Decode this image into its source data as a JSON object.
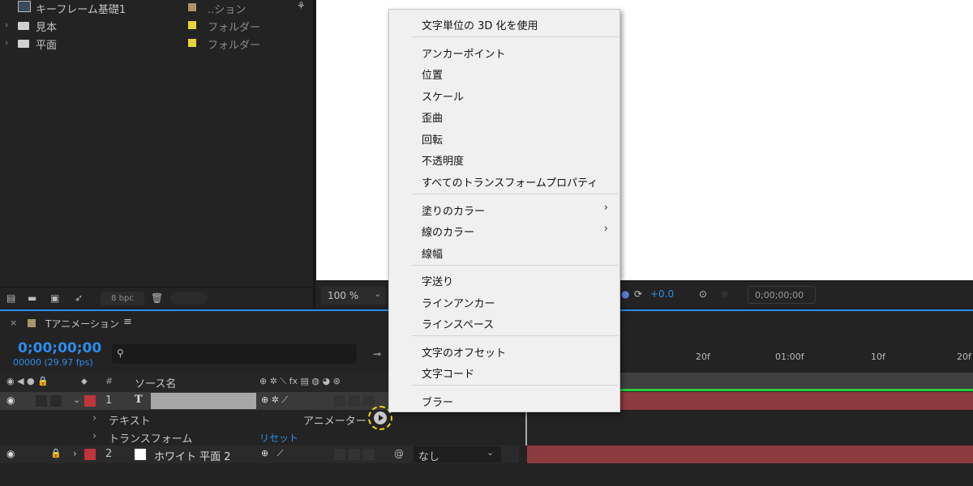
{
  "project": {
    "items": [
      {
        "name": "キーフレーム基礎1",
        "type": "..ション",
        "swatch": "#a89468"
      },
      {
        "name": "見本",
        "type": "フォルダー",
        "swatch": "#e4d43a"
      },
      {
        "name": "平面",
        "type": "フォルダー",
        "swatch": "#e4d43a"
      }
    ],
    "footer": {
      "bpc": "8 bpc"
    }
  },
  "viewer": {
    "zoom": "100 %",
    "exposure": "+0.0",
    "timecode": "0;00;00;00"
  },
  "timeline": {
    "tab_title": "Tアニメーション",
    "timecode": "0;00;00;00",
    "frame_info": "00000 (29.97 fps)",
    "col_source_name": "ソース名",
    "col_hash": "#",
    "ruler_ticks": [
      "20f",
      "01:00f",
      "10f",
      "20f"
    ],
    "layers": [
      {
        "index": "1",
        "type_icon": "T",
        "name": "",
        "label_color": "#c0343a"
      },
      {
        "index": "2",
        "name": "ホワイト 平面 2",
        "label_color": "#c0343a",
        "parent": "なし"
      }
    ],
    "sub_rows": [
      {
        "label": "テキスト",
        "right": "アニメーター"
      },
      {
        "label": "トランスフォーム",
        "right": "リセット"
      }
    ]
  },
  "menu": {
    "groups": [
      [
        {
          "label": "文字単位の 3D 化を使用"
        }
      ],
      [
        {
          "label": "アンカーポイント"
        },
        {
          "label": "位置"
        },
        {
          "label": "スケール"
        },
        {
          "label": "歪曲"
        },
        {
          "label": "回転"
        },
        {
          "label": "不透明度"
        },
        {
          "label": "すべてのトランスフォームプロパティ"
        }
      ],
      [
        {
          "label": "塗りのカラー",
          "submenu": true
        },
        {
          "label": "線のカラー",
          "submenu": true
        },
        {
          "label": "線幅"
        }
      ],
      [
        {
          "label": "字送り"
        },
        {
          "label": "ラインアンカー"
        },
        {
          "label": "ラインスペース"
        }
      ],
      [
        {
          "label": "文字のオフセット"
        },
        {
          "label": "文字コード"
        }
      ],
      [
        {
          "label": "ブラー"
        }
      ]
    ]
  },
  "colors": {
    "accent": "#2d8ceb",
    "highlight_ring": "#f2d21b",
    "layer_bar": "#8d3a3f"
  }
}
